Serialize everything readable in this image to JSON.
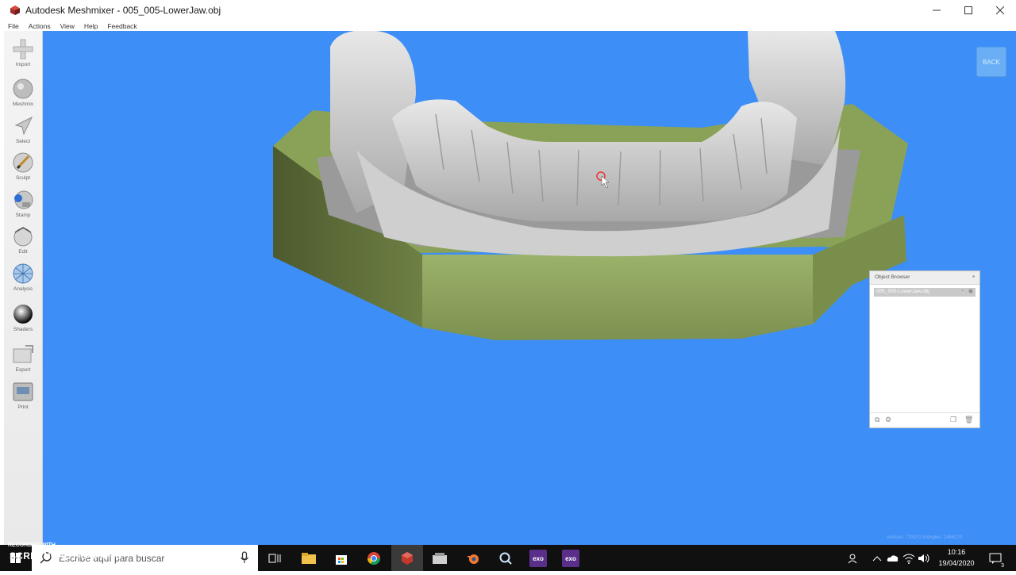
{
  "window": {
    "title": "Autodesk Meshmixer - 005_005-LowerJaw.obj",
    "controls": [
      "minimize",
      "maximize",
      "close"
    ]
  },
  "menu": [
    "File",
    "Actions",
    "View",
    "Help",
    "Feedback"
  ],
  "tools": [
    {
      "label": "Import",
      "icon": "plus-icon"
    },
    {
      "label": "Meshmix",
      "icon": "meshmix-icon"
    },
    {
      "label": "Select",
      "icon": "select-arrow-icon"
    },
    {
      "label": "Sculpt",
      "icon": "brush-icon"
    },
    {
      "label": "Stamp",
      "icon": "stamp-icon"
    },
    {
      "label": "Edit",
      "icon": "edit-icon"
    },
    {
      "label": "Analysis",
      "icon": "analysis-icon"
    },
    {
      "label": "Shaders",
      "icon": "shader-sphere-icon"
    },
    {
      "label": "Export",
      "icon": "export-icon"
    },
    {
      "label": "Print",
      "icon": "print-icon"
    }
  ],
  "viewport": {
    "background": "#3d8ef7",
    "back_label": "BACK",
    "stats": "vertices: 733202 triangles: 1466270"
  },
  "object_browser": {
    "title": "Object Browser",
    "items": [
      {
        "name": "005_005-LowerJaw.obj"
      }
    ]
  },
  "taskbar": {
    "watermark_top": "RECORDED WITH",
    "watermark_brand": "SCREENCAST-O-MATIC",
    "search_placeholder": "Escribe aquí para buscar",
    "pinned": [
      "task-view-icon",
      "file-explorer-icon",
      "store-icon",
      "chrome-icon",
      "meshmixer-icon",
      "files-icon",
      "blender-icon",
      "search-app-icon",
      "exo-icon",
      "exo-icon"
    ],
    "exo_label": "exo",
    "time": "10:16",
    "date": "19/04/2020",
    "notifications": "3"
  }
}
